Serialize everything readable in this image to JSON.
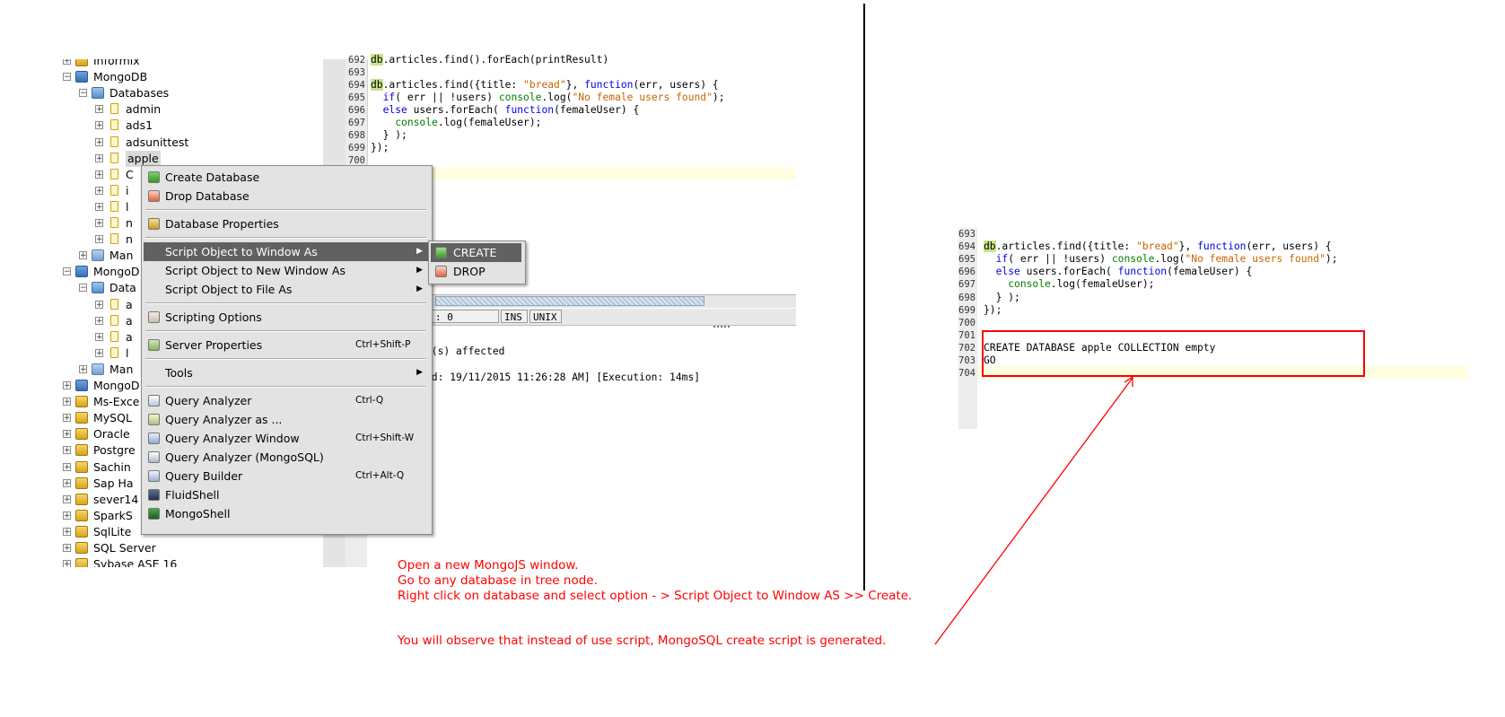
{
  "tree": {
    "items": [
      {
        "label": "Informix",
        "level": 1,
        "expander": "+",
        "icon": "server-icon"
      },
      {
        "label": "MongoDB",
        "level": 1,
        "expander": "−",
        "icon": "mongodb-server-icon"
      },
      {
        "label": "Databases",
        "level": 2,
        "expander": "−",
        "icon": "databases-folder-icon"
      },
      {
        "label": "admin",
        "level": 3,
        "expander": "+",
        "icon": "database-icon"
      },
      {
        "label": "ads1",
        "level": 3,
        "expander": "+",
        "icon": "database-icon"
      },
      {
        "label": "adsunittest",
        "level": 3,
        "expander": "+",
        "icon": "database-icon"
      },
      {
        "label": "apple",
        "level": 3,
        "expander": "+",
        "icon": "database-icon"
      },
      {
        "label": "C",
        "level": 3,
        "expander": "+",
        "icon": "database-icon"
      },
      {
        "label": "i",
        "level": 3,
        "expander": "+",
        "icon": "database-icon"
      },
      {
        "label": "l",
        "level": 3,
        "expander": "+",
        "icon": "database-icon"
      },
      {
        "label": "n",
        "level": 3,
        "expander": "+",
        "icon": "database-icon"
      },
      {
        "label": "n",
        "level": 3,
        "expander": "+",
        "icon": "database-icon"
      },
      {
        "label": "Man",
        "level": 2,
        "expander": "+",
        "icon": "management-icon"
      },
      {
        "label": "MongoD",
        "level": 1,
        "expander": "−",
        "icon": "mongodb-server-icon"
      },
      {
        "label": "Data",
        "level": 2,
        "expander": "−",
        "icon": "databases-folder-icon"
      },
      {
        "label": "a",
        "level": 3,
        "expander": "+",
        "icon": "database-icon"
      },
      {
        "label": "a",
        "level": 3,
        "expander": "+",
        "icon": "database-icon"
      },
      {
        "label": "a",
        "level": 3,
        "expander": "+",
        "icon": "database-icon"
      },
      {
        "label": "l",
        "level": 3,
        "expander": "+",
        "icon": "database-icon"
      },
      {
        "label": "Man",
        "level": 2,
        "expander": "+",
        "icon": "management-icon"
      },
      {
        "label": "MongoD",
        "level": 1,
        "expander": "+",
        "icon": "mongodb-server-icon"
      },
      {
        "label": "Ms-Exce",
        "level": 1,
        "expander": "+",
        "icon": "server-icon"
      },
      {
        "label": "MySQL",
        "level": 1,
        "expander": "+",
        "icon": "server-icon"
      },
      {
        "label": "Oracle",
        "level": 1,
        "expander": "+",
        "icon": "server-icon"
      },
      {
        "label": "Postgre",
        "level": 1,
        "expander": "+",
        "icon": "server-icon"
      },
      {
        "label": "Sachin",
        "level": 1,
        "expander": "+",
        "icon": "server-icon"
      },
      {
        "label": "Sap Ha",
        "level": 1,
        "expander": "+",
        "icon": "server-icon"
      },
      {
        "label": "sever14",
        "level": 1,
        "expander": "+",
        "icon": "server-icon"
      },
      {
        "label": "SparkS",
        "level": 1,
        "expander": "+",
        "icon": "server-icon"
      },
      {
        "label": "SqlLite",
        "level": 1,
        "expander": "+",
        "icon": "server-icon"
      },
      {
        "label": "SQL Server",
        "level": 1,
        "expander": "+",
        "icon": "server-icon"
      },
      {
        "label": "Sybase ASE 16",
        "level": 1,
        "expander": "+",
        "icon": "server-icon"
      }
    ]
  },
  "context_menu": {
    "items": [
      {
        "label": "Create Database",
        "icon": "plus-icon",
        "shortcut": "",
        "submenu": false
      },
      {
        "label": "Drop Database",
        "icon": "drop-icon",
        "shortcut": "",
        "submenu": false
      },
      {
        "separator": true
      },
      {
        "label": "Database Properties",
        "icon": "properties-icon",
        "shortcut": "",
        "submenu": false
      },
      {
        "separator": true
      },
      {
        "label": "Script Object to Window As",
        "icon": "",
        "shortcut": "",
        "submenu": true,
        "selected": true
      },
      {
        "label": "Script Object to New Window As",
        "icon": "",
        "shortcut": "",
        "submenu": true
      },
      {
        "label": "Script Object to File As",
        "icon": "",
        "shortcut": "",
        "submenu": true
      },
      {
        "separator": true
      },
      {
        "label": "Scripting Options",
        "icon": "scripting-options-icon",
        "shortcut": "",
        "submenu": false
      },
      {
        "separator": true
      },
      {
        "label": "Server Properties",
        "icon": "server-properties-icon",
        "shortcut": "Ctrl+Shift-P",
        "submenu": false
      },
      {
        "separator": true
      },
      {
        "label": "Tools",
        "icon": "",
        "shortcut": "",
        "submenu": true
      },
      {
        "separator": true
      },
      {
        "label": "Query Analyzer",
        "icon": "query-analyzer-icon",
        "shortcut": "Ctrl-Q",
        "submenu": false
      },
      {
        "label": "Query Analyzer as ...",
        "icon": "query-analyzer-as-icon",
        "shortcut": "",
        "submenu": false
      },
      {
        "label": "Query Analyzer Window",
        "icon": "query-window-icon",
        "shortcut": "Ctrl+Shift-W",
        "submenu": false
      },
      {
        "label": "Query Analyzer (MongoSQL)",
        "icon": "query-mongosql-icon",
        "shortcut": "",
        "submenu": false
      },
      {
        "label": "Query Builder",
        "icon": "query-builder-icon",
        "shortcut": "Ctrl+Alt-Q",
        "submenu": false
      },
      {
        "label": "FluidShell",
        "icon": "fluidshell-icon",
        "shortcut": "",
        "submenu": false
      },
      {
        "label": "MongoShell",
        "icon": "mongoshell-icon",
        "shortcut": "",
        "submenu": false
      }
    ]
  },
  "submenu": {
    "items": [
      {
        "label": "CREATE",
        "icon": "create-script-icon",
        "selected": true
      },
      {
        "label": "DROP",
        "icon": "drop-script-icon",
        "selected": false
      }
    ]
  },
  "left_editor": {
    "lines": [
      {
        "num": "692",
        "code": "db.articles.find().forEach(printResult)"
      },
      {
        "num": "693",
        "code": ""
      },
      {
        "num": "694",
        "code": "db.articles.find({title: \"bread\"}, function(err, users) {"
      },
      {
        "num": "695",
        "code": "  if( err || !users) console.log(\"No female users found\");"
      },
      {
        "num": "696",
        "code": "  else users.forEach( function(femaleUser) {"
      },
      {
        "num": "697",
        "code": "    console.log(femaleUser);"
      },
      {
        "num": "698",
        "code": "  } );"
      },
      {
        "num": "699",
        "code": "});"
      },
      {
        "num": "700",
        "code": ""
      }
    ],
    "status": {
      "position": ": 0",
      "mode": "INS",
      "eol": "UNIX"
    },
    "output": {
      "line1": "d(s) affected",
      "line2": "ed: 19/11/2015 11:26:28 AM] [Execution: 14ms]"
    }
  },
  "right_editor": {
    "lines": [
      {
        "num": "693",
        "code": ""
      },
      {
        "num": "694",
        "code": "db.articles.find({title: \"bread\"}, function(err, users) {"
      },
      {
        "num": "695",
        "code": "  if( err || !users) console.log(\"No female users found\");"
      },
      {
        "num": "696",
        "code": "  else users.forEach( function(femaleUser) {"
      },
      {
        "num": "697",
        "code": "    console.log(femaleUser);"
      },
      {
        "num": "698",
        "code": "  } );"
      },
      {
        "num": "699",
        "code": "});"
      },
      {
        "num": "700",
        "code": ""
      },
      {
        "num": "701",
        "code": ""
      },
      {
        "num": "702",
        "code": "CREATE DATABASE apple COLLECTION empty"
      },
      {
        "num": "703",
        "code": "GO"
      },
      {
        "num": "704",
        "code": ""
      }
    ]
  },
  "annotations": {
    "line1": "Open a new MongoJS window.",
    "line2": "Go to any database in tree node.",
    "line3": "Right click on database and select option - > Script Object to Window AS >> Create.",
    "line4": "You will observe that instead of use script, MongoSQL create script is generated."
  },
  "colors": {
    "annotation": "#ff0000",
    "menu_selected": "#616161",
    "keyword": "#0000e6",
    "string": "#c86400",
    "console": "#008000",
    "current_line": "#ffffe0"
  }
}
